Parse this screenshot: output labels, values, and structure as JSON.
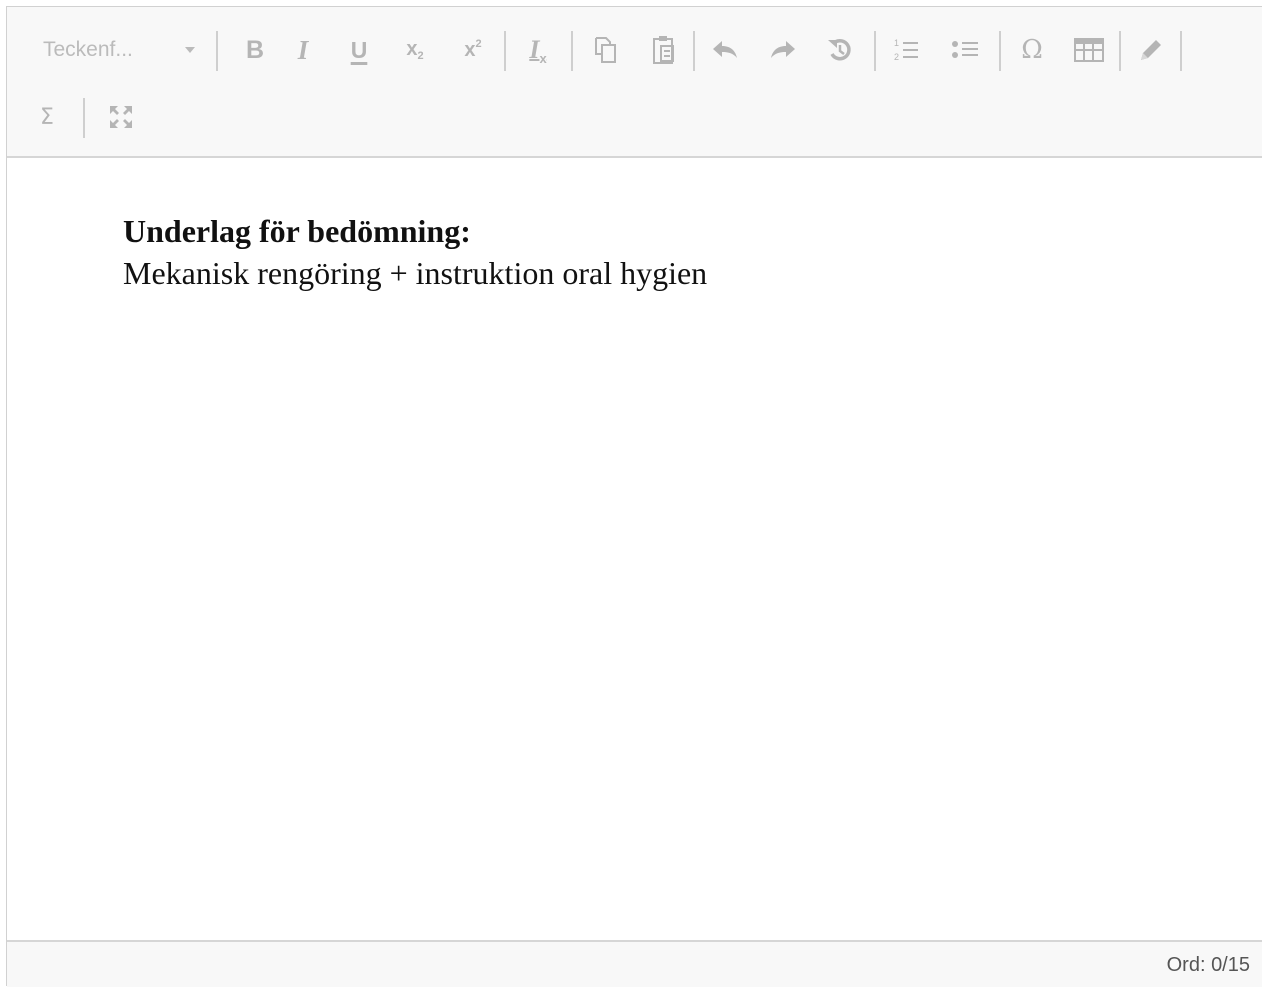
{
  "toolbar": {
    "font_select": {
      "value": "Teckenf..."
    },
    "buttons": [
      {
        "name": "bold-button",
        "icon": "bold-icon"
      },
      {
        "name": "italic-button",
        "icon": "italic-icon"
      },
      {
        "name": "underline-button",
        "icon": "underline-icon"
      },
      {
        "name": "subscript-button",
        "icon": "subscript-icon"
      },
      {
        "name": "superscript-button",
        "icon": "superscript-icon"
      },
      {
        "name": "remove-format-button",
        "icon": "remove-format-icon"
      },
      {
        "name": "copy-button",
        "icon": "copy-icon"
      },
      {
        "name": "paste-button",
        "icon": "paste-icon"
      },
      {
        "name": "undo-button",
        "icon": "undo-icon"
      },
      {
        "name": "redo-button",
        "icon": "redo-icon"
      },
      {
        "name": "restore-button",
        "icon": "restore-icon"
      },
      {
        "name": "numbered-list-button",
        "icon": "numbered-list-icon"
      },
      {
        "name": "bulleted-list-button",
        "icon": "bulleted-list-icon"
      },
      {
        "name": "special-char-button",
        "icon": "omega-icon"
      },
      {
        "name": "table-button",
        "icon": "table-icon"
      },
      {
        "name": "draw-button",
        "icon": "pencil-icon"
      },
      {
        "name": "formula-button",
        "icon": "sigma-icon"
      },
      {
        "name": "maximize-button",
        "icon": "maximize-icon"
      }
    ],
    "icon_color": "#b5b5b5"
  },
  "document": {
    "heading": "Underlag för bedömning:",
    "body": "Mekanisk rengöring + instruktion oral hygien"
  },
  "status": {
    "word_count": "Ord: 0/15"
  }
}
